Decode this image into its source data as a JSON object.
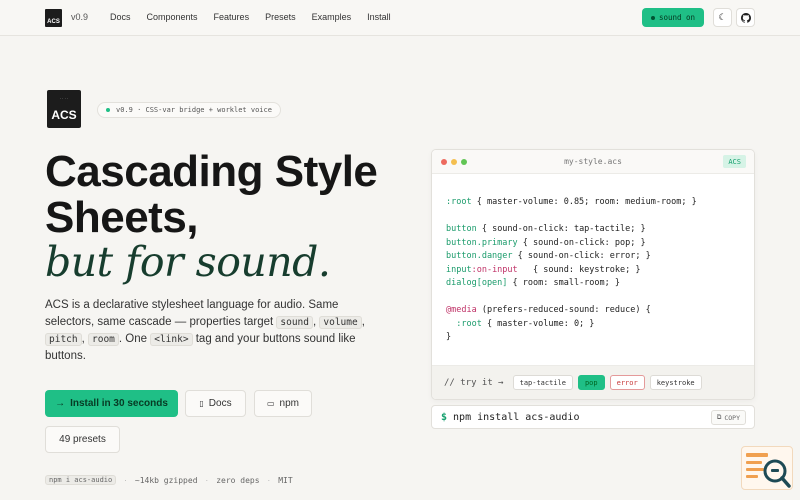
{
  "nav": {
    "logo_text": "ACS",
    "version": "v0.9",
    "links": [
      "Docs",
      "Components",
      "Features",
      "Presets",
      "Examples",
      "Install"
    ],
    "sound_label": "sound on",
    "theme_icon": "moon-icon",
    "github_icon": "github-icon"
  },
  "hero": {
    "logo_text": "ACS",
    "pill_text": "v0.9 · CSS-var bridge + worklet voice",
    "title_line1": "Cascading Style",
    "title_line2": "Sheets,",
    "title_line3": "but for sound.",
    "desc_a": "ACS is a declarative stylesheet language for audio. Same selectors, same cascade — properties target ",
    "code_sound": "sound",
    "code_volume": "volume",
    "code_pitch": "pitch",
    "code_room": "room",
    "desc_b": ". One ",
    "code_link": "<link>",
    "desc_c": " tag and your buttons sound like buttons.",
    "btn_install": "Install in 30 seconds",
    "btn_docs": "Docs",
    "btn_npm": "npm",
    "btn_presets": "49 presets",
    "foot_cmd": "npm i acs-audio",
    "foot_size": "~14kb gzipped",
    "foot_deps": "zero deps",
    "foot_license": "MIT"
  },
  "editor": {
    "filename": "my-style.acs",
    "badge": "ACS",
    "lines": {
      "l1_sel": ":root",
      "l1_rest": " { master-volume: 0.85; room: medium-room; }",
      "l2_sel": "button",
      "l2_rest": " { sound-on-click: tap-tactile; }",
      "l3_sel": "button.primary",
      "l3_rest": " { sound-on-click: pop; }",
      "l4_sel": "button.danger",
      "l4_rest": " { sound-on-click: error; }",
      "l5_sel": "input",
      "l5_pseudo": ":on-input",
      "l5_rest": "   { sound: keystroke; }",
      "l6_sel": "dialog[open]",
      "l6_rest": " { room: small-room; }",
      "l7_at": "@media",
      "l7_rest": " (prefers-reduced-sound: reduce) {",
      "l8_sel": "  :root",
      "l8_rest": " { master-volume: 0; }",
      "l9": "}"
    },
    "try_label": "// try it →",
    "chips": [
      "tap-tactile",
      "pop",
      "error",
      "keystroke"
    ]
  },
  "install": {
    "command": "npm install acs-audio",
    "copy_label": "COPY"
  },
  "colors": {
    "accent": "#1fbf86",
    "background": "#f6f5f2",
    "title_italic": "#173d2e"
  }
}
